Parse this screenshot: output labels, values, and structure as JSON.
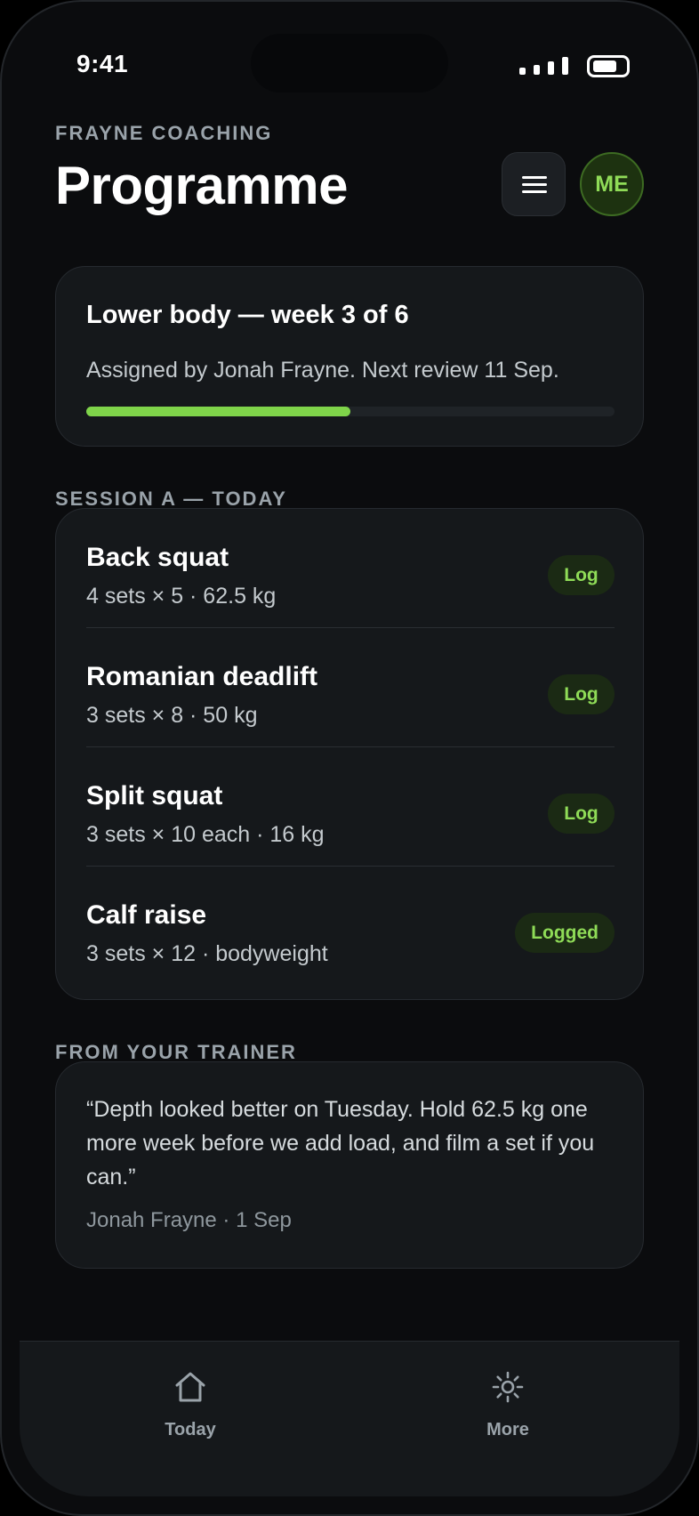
{
  "status_bar": {
    "time": "9:41"
  },
  "header": {
    "eyebrow": "FRAYNE COACHING",
    "title": "Programme",
    "avatar_initials": "ME"
  },
  "programme": {
    "title": "Lower body — week 3 of 6",
    "subtitle": "Assigned by Jonah Frayne. Next review 11 Sep.",
    "progress": 0.5
  },
  "session": {
    "label": "SESSION A — TODAY",
    "exercises": [
      {
        "name": "Back squat",
        "detail": "4 sets × 5 · 62.5 kg",
        "action": "Log"
      },
      {
        "name": "Romanian deadlift",
        "detail": "3 sets × 8 · 50 kg",
        "action": "Log"
      },
      {
        "name": "Split squat",
        "detail": "3 sets × 10 each · 16 kg",
        "action": "Log"
      },
      {
        "name": "Calf raise",
        "detail": "3 sets × 12 · bodyweight",
        "action": "Logged"
      }
    ]
  },
  "trainer": {
    "label": "FROM YOUR TRAINER",
    "quote": "“Depth looked better on Tuesday. Hold 62.5 kg one more week before we add load, and film a set if you can.”",
    "meta": "Jonah Frayne · 1 Sep"
  },
  "tabbar": {
    "items": [
      {
        "label": "Today",
        "icon": "home-icon"
      },
      {
        "label": "More",
        "icon": "gear-icon"
      }
    ]
  },
  "colors": {
    "accent": "#7fd44a",
    "background": "#0b0c0e",
    "card": "#15181b"
  }
}
